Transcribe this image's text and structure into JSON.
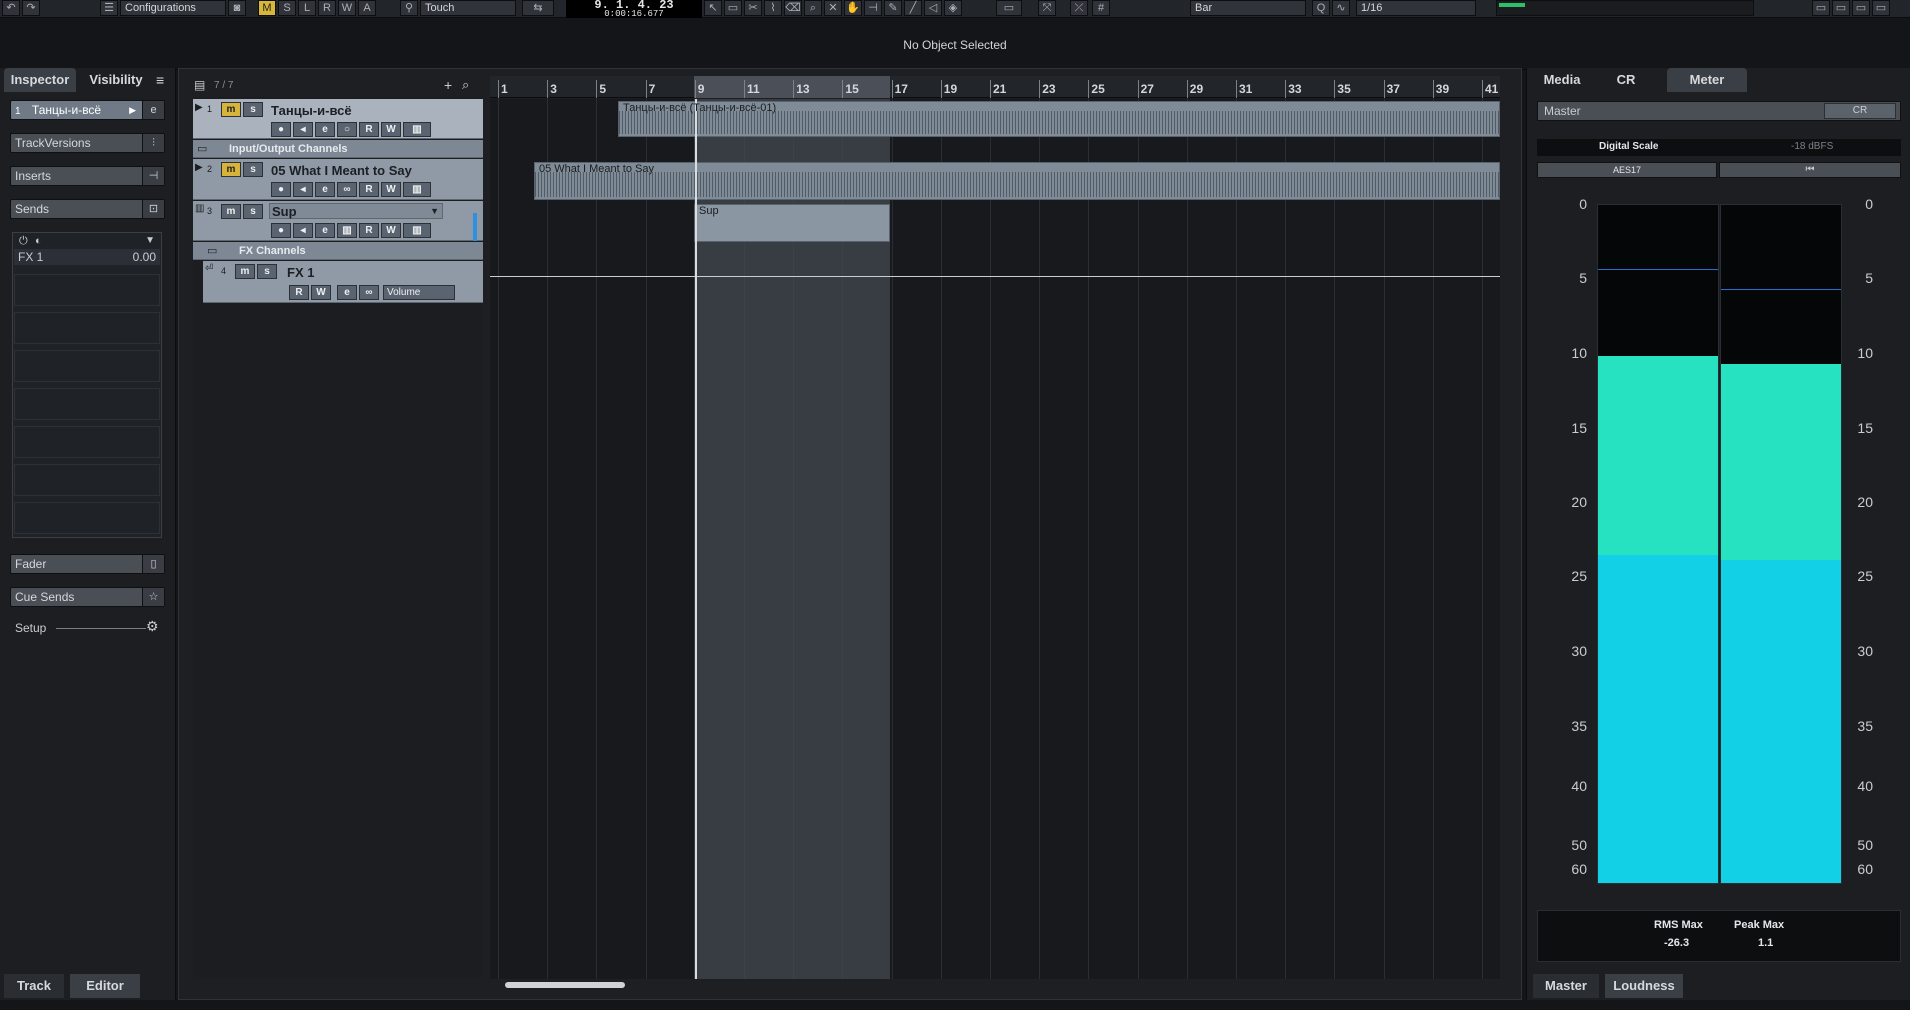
{
  "toolbar": {
    "configurations": "Configurations",
    "mode_m": "M",
    "mode_s": "S",
    "mode_l": "L",
    "mode_r": "R",
    "mode_w": "W",
    "mode_a": "A",
    "automation_mode": "Touch",
    "transport_position": "9. 1. 4. 23",
    "transport_time": "0:00:16.677",
    "grid_type": "Bar",
    "quantize": "1/16"
  },
  "status": {
    "text": "No Object Selected"
  },
  "inspector": {
    "tab_inspector": "Inspector",
    "tab_visibility": "Visibility",
    "track_num": "1",
    "track_name": "Танцы-и-всё",
    "track_versions": "TrackVersions",
    "inserts": "Inserts",
    "sends": "Sends",
    "send_name": "FX 1",
    "send_value": "0.00",
    "fader": "Fader",
    "cue_sends": "Cue Sends",
    "setup": "Setup",
    "bottom_track": "Track",
    "bottom_editor": "Editor"
  },
  "project": {
    "track_count": "7 / 7",
    "tracks": [
      {
        "num": "1",
        "name": "Танцы-и-всё"
      },
      {
        "num": "2",
        "name": "05 What I Meant to Say"
      },
      {
        "num": "3",
        "name": "Sup"
      },
      {
        "num": "4",
        "name": "FX 1",
        "volume": "Volume"
      }
    ],
    "folders": {
      "io": "Input/Output Channels",
      "fx": "FX Channels"
    },
    "ruler": [
      "1",
      "3",
      "5",
      "7",
      "9",
      "11",
      "13",
      "15",
      "17",
      "19",
      "21",
      "23",
      "25",
      "27",
      "29",
      "31",
      "33",
      "35",
      "37",
      "39",
      "41"
    ],
    "events": {
      "e1": "Танцы-и-всё (Танцы-и-всё-01)",
      "e2": "05 What I Meant to Say",
      "e3": "Sup"
    }
  },
  "meter_panel": {
    "tab_media": "Media",
    "tab_cr": "CR",
    "tab_meter": "Meter",
    "channel": "Master",
    "channel_btn": "CR",
    "scale_name": "Digital Scale",
    "ref_level": "-18 dBFS",
    "standard": "AES17",
    "scale_left": [
      "0",
      "5",
      "10",
      "15",
      "20",
      "25",
      "30",
      "35",
      "40",
      "50",
      "60"
    ],
    "scale_right": [
      "0",
      "5",
      "10",
      "15",
      "20",
      "25",
      "30",
      "35",
      "40",
      "50",
      "60"
    ],
    "left_level_db": 13.5,
    "right_level_db": 14.2,
    "rms_max_label": "RMS Max",
    "peak_max_label": "Peak Max",
    "rms_max": "-26.3",
    "peak_max": "1.1",
    "bottom_master": "Master",
    "bottom_loudness": "Loudness"
  },
  "colors": {
    "meter_rms": "#12d0e6",
    "meter_peak": "#26e2c0",
    "mute_active": "#d6b43b",
    "track_bg": "#8f9aa6"
  }
}
